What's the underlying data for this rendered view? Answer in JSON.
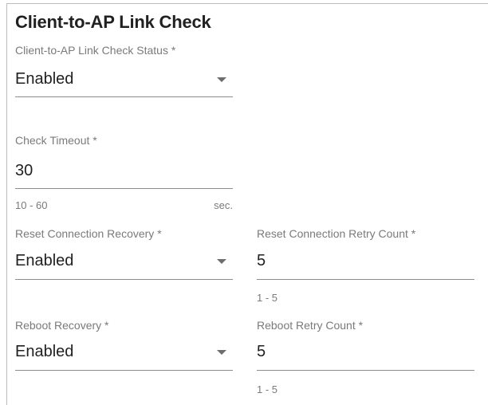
{
  "section": {
    "title": "Client-to-AP Link Check"
  },
  "link_check_status": {
    "label": "Client-to-AP Link Check Status *",
    "value": "Enabled"
  },
  "check_timeout": {
    "label": "Check Timeout *",
    "value": "30",
    "range_hint": "10 - 60",
    "unit": "sec."
  },
  "reset_connection_recovery": {
    "label": "Reset Connection Recovery *",
    "value": "Enabled"
  },
  "reset_connection_retry_count": {
    "label": "Reset Connection Retry Count *",
    "value": "5",
    "range_hint": "1 - 5"
  },
  "reboot_recovery": {
    "label": "Reboot Recovery *",
    "value": "Enabled"
  },
  "reboot_retry_count": {
    "label": "Reboot Retry Count *",
    "value": "5",
    "range_hint": "1 - 5"
  },
  "colors": {
    "text": "#212121",
    "label": "#7a7a7a",
    "underline": "#8c8c8c",
    "frame": "#bdbdbd"
  },
  "icons": [
    "dropdown-caret-icon"
  ]
}
